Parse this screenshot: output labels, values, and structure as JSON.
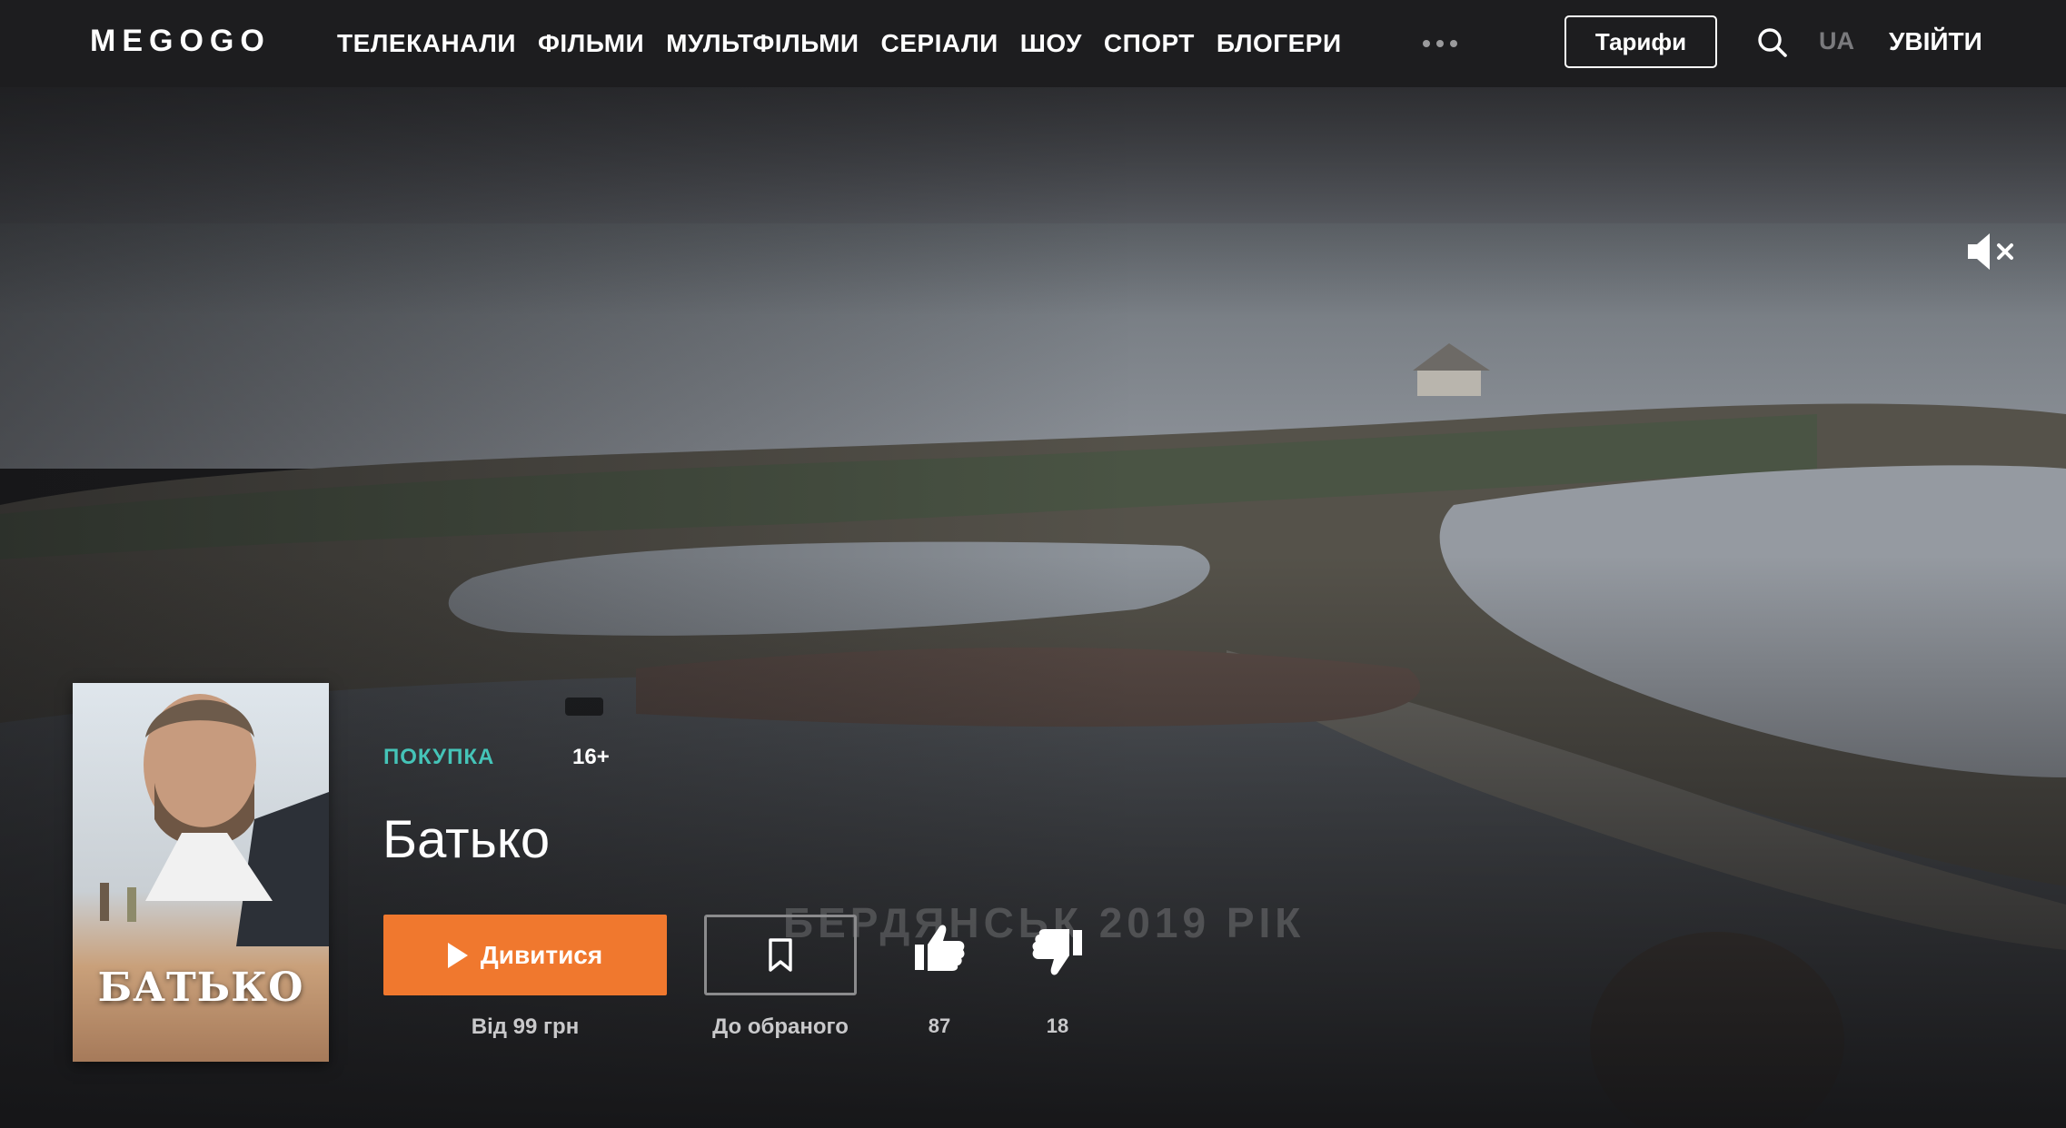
{
  "header": {
    "logo": "MEGOGO",
    "nav": [
      "ТЕЛЕКАНАЛИ",
      "ФІЛЬМИ",
      "МУЛЬТФІЛЬМИ",
      "СЕРІАЛИ",
      "ШОУ",
      "СПОРТ",
      "БЛОГЕРИ"
    ],
    "more_icon": "more-dots-icon",
    "tariffs_label": "Тарифи",
    "search_icon": "search-icon",
    "language": "UA",
    "login_label": "УВІЙТИ"
  },
  "hero": {
    "caption": "БЕРДЯНСЬК 2019 РІК",
    "mute_icon": "speaker-muted-icon"
  },
  "movie": {
    "poster_title": "БАТЬКО",
    "badge_purchase": "ПОКУПКА",
    "age_rating": "16+",
    "title": "Батько",
    "watch_label": "Дивитися",
    "price_label": "Від 99 грн",
    "favorite_label": "До обраного",
    "likes": "87",
    "dislikes": "18"
  },
  "colors": {
    "accent": "#f0782e",
    "purchase": "#45c4b8",
    "header_bg": "#1d1d1f"
  }
}
